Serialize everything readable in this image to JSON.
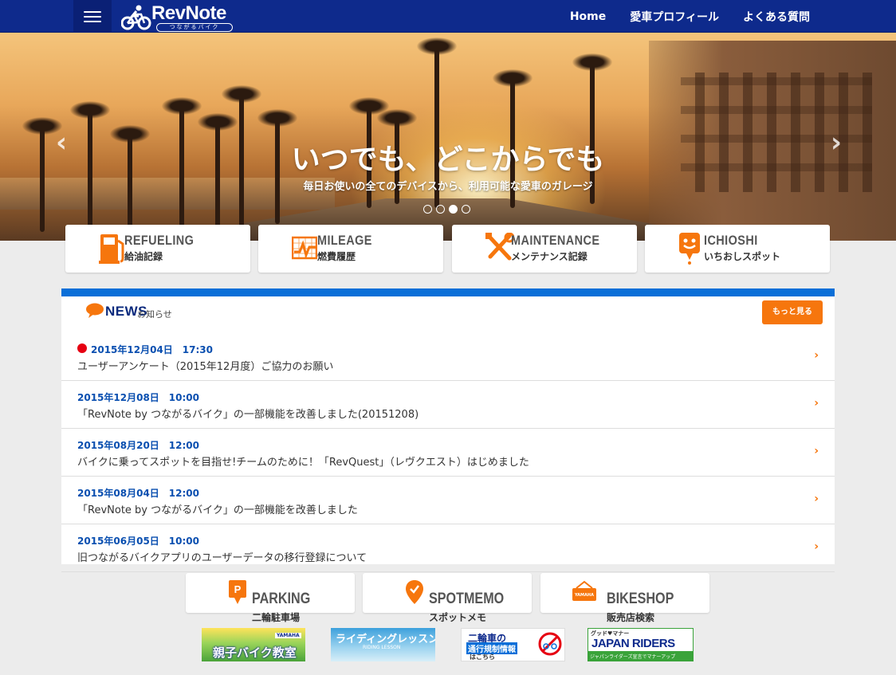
{
  "header": {
    "logo_text": "RevNote",
    "logo_sub": "つながるバイク",
    "nav": [
      {
        "label": "Home"
      },
      {
        "label": "愛車プロフィール"
      },
      {
        "label": "よくある質問"
      }
    ]
  },
  "hero": {
    "title": "いつでも、どこからでも",
    "subtitle": "毎日お使いの全てのデバイスから、利用可能な愛車のガレージ",
    "slide_count": 4,
    "active_slide": 3
  },
  "features": [
    {
      "title": "REFUELING",
      "sub": "給油記録",
      "icon": "fuel-pump-icon"
    },
    {
      "title": "MILEAGE",
      "sub": "燃費履歴",
      "icon": "mileage-chart-icon"
    },
    {
      "title": "MAINTENANCE",
      "sub": "メンテナンス記録",
      "icon": "wrench-icon"
    },
    {
      "title": "ICHIOSHI",
      "sub": "いちおしスポット",
      "icon": "spot-pin-icon"
    }
  ],
  "news": {
    "title": "NEWS",
    "title_sub": "お知らせ",
    "more_label": "もっと見る",
    "items": [
      {
        "date": "2015年12月04日　17:30",
        "text": "ユーザーアンケート（2015年12月度）ご協力のお願い",
        "new": true
      },
      {
        "date": "2015年12月08日　10:00",
        "text": "「RevNote by つながるバイク」の一部機能を改善しました(20151208)",
        "new": false
      },
      {
        "date": "2015年08月20日　12:00",
        "text": "バイクに乗ってスポットを目指せ!チームのために！「RevQuest」（レヴクエスト）はじめました",
        "new": false
      },
      {
        "date": "2015年08月04日　12:00",
        "text": "「RevNote by  つながるバイク」の一部機能を改善しました",
        "new": false
      },
      {
        "date": "2015年06月05日　10:00",
        "text": "旧つながるバイクアプリのユーザーデータの移行登録について",
        "new": false
      }
    ]
  },
  "bottom_cards": [
    {
      "title": "PARKING",
      "sub": "二輪駐車場",
      "icon": "parking-pin-icon"
    },
    {
      "title": "SPOTMEMO",
      "sub": "スポットメモ",
      "icon": "check-pin-icon"
    },
    {
      "title": "BIKESHOP",
      "sub": "販売店検索",
      "icon": "shop-sign-icon",
      "badge": "YAMAHA"
    }
  ],
  "banners": [
    {
      "text": "親子バイク教室",
      "badge": "YAMAHA"
    },
    {
      "text": "ライディングレッスン",
      "sub": "RIDING LESSON"
    },
    {
      "text": "二輪車の",
      "text2": "通行規制情報",
      "text3": "はこちら"
    },
    {
      "text": "グッド♥マナー",
      "text2": "JAPAN RIDERS",
      "text3": "ジャパンライダーズ宣言でマナーアップ"
    }
  ],
  "colors": {
    "header": "#0e2a8c",
    "accent": "#f6760d",
    "news_bar": "#0a6fd8",
    "date": "#0a4fb0",
    "new_dot": "#e60012"
  }
}
